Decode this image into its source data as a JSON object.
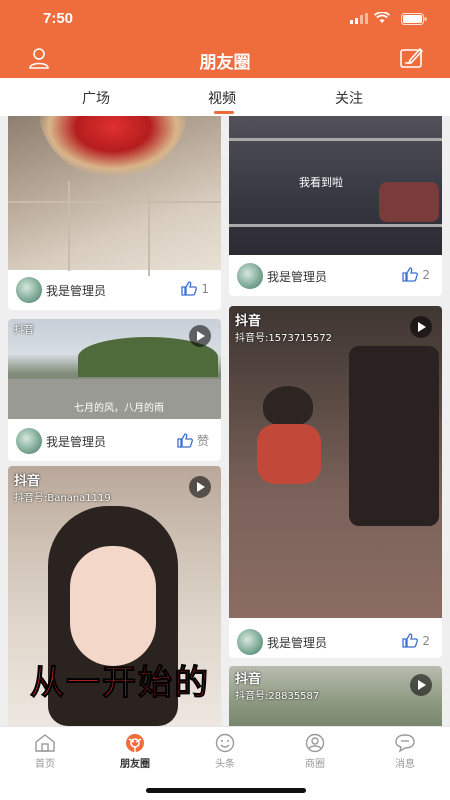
{
  "status_bar": {
    "time": "7:50"
  },
  "header": {
    "title": "朋友圈",
    "left_icon": "user-icon",
    "right_icon": "edit-icon"
  },
  "tabs": [
    {
      "label": "广场"
    },
    {
      "label": "视频",
      "active": true
    },
    {
      "label": "关注"
    }
  ],
  "feed": {
    "left": [
      {
        "user": "我是管理员",
        "likes": "1"
      },
      {
        "user": "我是管理员",
        "likes": "赞",
        "caption": "七月的风，八月的雨",
        "watermark": "抖音"
      },
      {
        "watermark": "抖音",
        "douyin_id": "抖音号:Banana1119",
        "caption": "从一开始的"
      }
    ],
    "right": [
      {
        "user": "我是管理员",
        "likes": "2",
        "caption": "我看到啦"
      },
      {
        "user": "我是管理员",
        "likes": "2",
        "watermark": "抖音",
        "douyin_id": "抖音号:1573715572"
      },
      {
        "watermark": "抖音",
        "douyin_id": "抖音号:28835587"
      }
    ]
  },
  "bottom_nav": [
    {
      "label": "首页",
      "icon": "home-icon"
    },
    {
      "label": "朋友圈",
      "icon": "moments-icon",
      "active": true
    },
    {
      "label": "头条",
      "icon": "smile-icon"
    },
    {
      "label": "商圈",
      "icon": "shop-icon"
    },
    {
      "label": "消息",
      "icon": "message-icon"
    }
  ],
  "colors": {
    "accent": "#ef6d3d",
    "like_blue": "#3a6fd1"
  }
}
